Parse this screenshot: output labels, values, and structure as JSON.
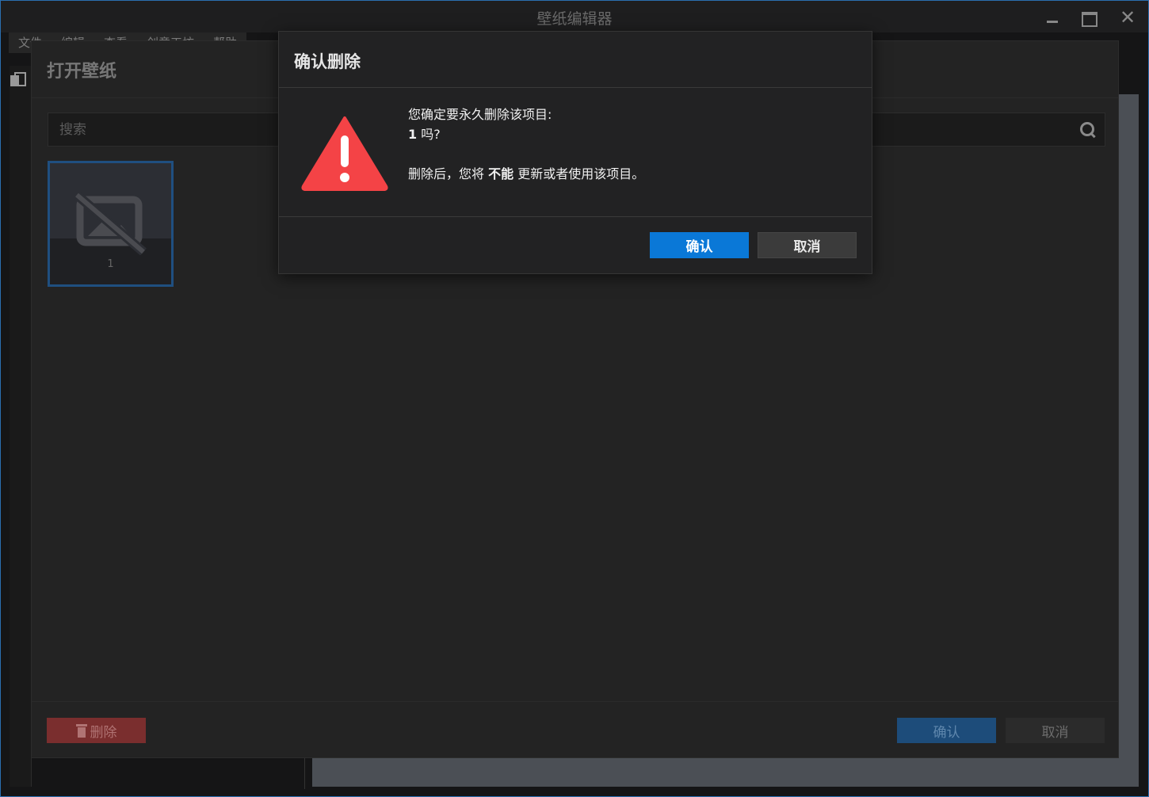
{
  "app": {
    "title": "壁纸编辑器"
  },
  "menubar": {
    "items": [
      {
        "label": "文件"
      },
      {
        "label": "编辑"
      },
      {
        "label": "查看"
      },
      {
        "label": "创意工坊"
      },
      {
        "label": "帮助"
      }
    ]
  },
  "open_panel": {
    "title": "打开壁纸",
    "search_placeholder": "搜索",
    "search_icon": "search-icon",
    "items": [
      {
        "label": "1",
        "icon": "no-image-icon"
      }
    ],
    "delete_label": "删除",
    "delete_icon": "trash-icon",
    "confirm_label": "确认",
    "cancel_label": "取消"
  },
  "dialog": {
    "title": "确认删除",
    "warning_icon": "warning-icon",
    "line1": "您确定要永久删除该项目:",
    "item_name": "1",
    "item_suffix": " 吗?",
    "line3_prefix": "删除后，您将 ",
    "line3_bold": "不能",
    "line3_suffix": " 更新或者使用该项目。",
    "confirm_label": "确认",
    "cancel_label": "取消"
  },
  "colors": {
    "accent": "#0a78d7",
    "danger": "#f44346",
    "delete_button": "#7a2e2e"
  }
}
